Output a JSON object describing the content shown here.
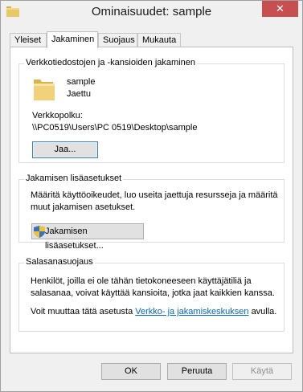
{
  "window": {
    "title": "Ominaisuudet: sample",
    "close_label": "✕",
    "title_icon": "folder-icon"
  },
  "tabs": [
    {
      "label": "Yleiset"
    },
    {
      "label": "Jakaminen"
    },
    {
      "label": "Suojaus"
    },
    {
      "label": "Mukauta"
    }
  ],
  "network_sharing": {
    "title": "Verkkotiedostojen ja -kansioiden jakaminen",
    "folder_name": "sample",
    "folder_status": "Jaettu",
    "path_label": "Verkkopolku:",
    "path_value": "\\\\PC0519\\Users\\PC 0519\\Desktop\\sample",
    "share_button": "Jaa..."
  },
  "advanced": {
    "title": "Jakamisen lisäasetukset",
    "desc_line1": "Määritä käyttöoikeudet, luo useita jaettuja resursseja ja määritä",
    "desc_line2": "muut jakamisen asetukset.",
    "button": "Jakamisen lisäasetukset..."
  },
  "password": {
    "title": "Salasanasuojaus",
    "desc_line1": "Henkilöt, joilla ei ole tähän tietokoneeseen käyttäjätiliä ja",
    "desc_line2": "salasanaa, voivat käyttää kansioita, jotka jaat kaikkien kanssa.",
    "change_prefix": "Voit muuttaa tätä asetusta",
    "change_link": "Verkko- ja jakamiskeskuksen",
    "change_suffix": "avulla."
  },
  "buttons": {
    "ok": "OK",
    "cancel": "Peruuta",
    "apply": "Käytä"
  },
  "colors": {
    "close_button": "#c74f4f",
    "link": "#0066cc",
    "folder": "#e8c766"
  }
}
